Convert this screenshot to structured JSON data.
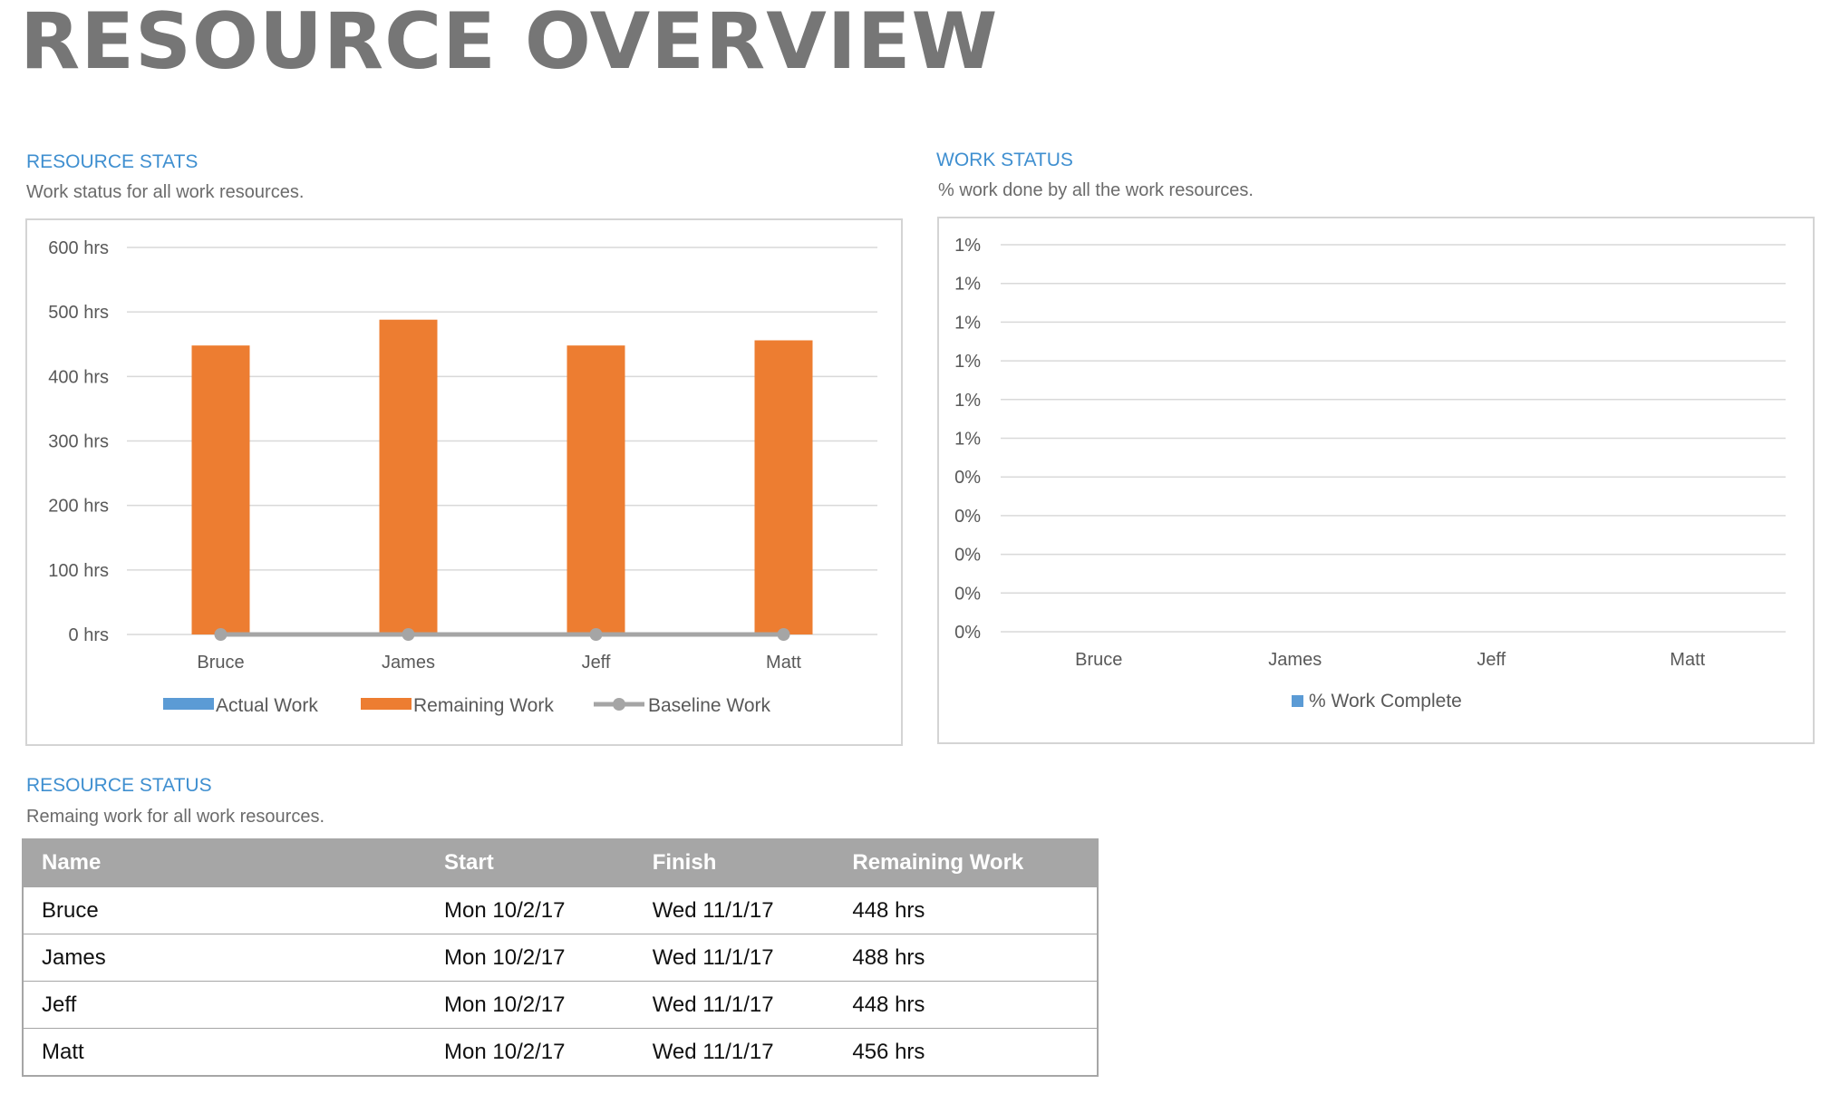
{
  "page": {
    "title": "RESOURCE OVERVIEW"
  },
  "resource_stats": {
    "title": "RESOURCE STATS",
    "subtitle": "Work status for all work resources."
  },
  "work_status": {
    "title": "WORK STATUS",
    "subtitle": "% work done by all the work resources."
  },
  "resource_status": {
    "title": "RESOURCE STATUS",
    "subtitle": "Remaing work for all work resources.",
    "columns": [
      "Name",
      "Start",
      "Finish",
      "Remaining Work"
    ],
    "rows": [
      [
        "Bruce",
        "Mon 10/2/17",
        "Wed 11/1/17",
        "448 hrs"
      ],
      [
        "James",
        "Mon 10/2/17",
        "Wed 11/1/17",
        "488 hrs"
      ],
      [
        "Jeff",
        "Mon 10/2/17",
        "Wed 11/1/17",
        "448 hrs"
      ],
      [
        "Matt",
        "Mon 10/2/17",
        "Wed 11/1/17",
        "456 hrs"
      ]
    ]
  },
  "colors": {
    "title": "#767676",
    "accent": "#3f8fd0",
    "actual_work": "#5b9bd5",
    "remaining_work": "#ed7d31",
    "baseline_work": "#a5a5a5",
    "percent_complete": "#5b9bd5",
    "table_header": "#a6a6a6"
  },
  "chart_data": [
    {
      "type": "bar",
      "categories": [
        "Bruce",
        "James",
        "Jeff",
        "Matt"
      ],
      "series": [
        {
          "name": "Actual Work",
          "kind": "bar",
          "values": [
            0,
            0,
            0,
            0
          ]
        },
        {
          "name": "Remaining Work",
          "kind": "bar",
          "values": [
            448,
            488,
            448,
            456
          ]
        },
        {
          "name": "Baseline Work",
          "kind": "line",
          "values": [
            0,
            0,
            0,
            0
          ]
        }
      ],
      "yticks": [
        "0 hrs",
        "100 hrs",
        "200 hrs",
        "300 hrs",
        "400 hrs",
        "500 hrs",
        "600 hrs"
      ],
      "ylim": [
        0,
        600
      ],
      "grid": true,
      "legend": "bottom"
    },
    {
      "type": "bar",
      "categories": [
        "Bruce",
        "James",
        "Jeff",
        "Matt"
      ],
      "series": [
        {
          "name": "% Work Complete",
          "values": [
            0,
            0,
            0,
            0
          ]
        }
      ],
      "yticks": [
        "0%",
        "0%",
        "0%",
        "0%",
        "0%",
        "1%",
        "1%",
        "1%",
        "1%",
        "1%",
        "1%"
      ],
      "grid": true,
      "legend": "bottom"
    }
  ]
}
